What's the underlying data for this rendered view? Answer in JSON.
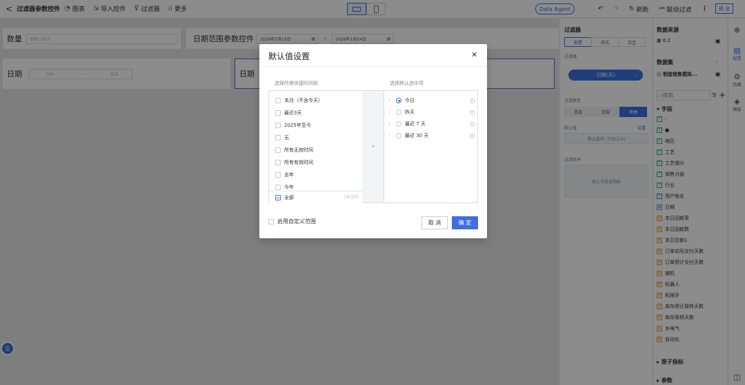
{
  "topbar": {
    "title": "过滤器参数控件",
    "items": [
      {
        "icon": "chart-icon",
        "label": "图表"
      },
      {
        "icon": "import-icon",
        "label": "导入控件"
      },
      {
        "icon": "filter-icon",
        "label": "过滤器"
      },
      {
        "icon": "more-icon",
        "label": "更多"
      }
    ],
    "data_agent": "Data Agent",
    "refresh": "刷新",
    "linked_filter": "联动过滤",
    "preview": "预 览"
  },
  "canvas": {
    "number_label": "数量",
    "number_placeholder": "请输入数字",
    "date_range_label": "日期范围参数控件",
    "date_from": "2026年1月23日",
    "date_sep": "-",
    "date_to": "2026年1月24日",
    "date_label": "日期",
    "start_placeholder": "开始",
    "arrow": "→",
    "end_placeholder": "结束",
    "date_label2": "日期"
  },
  "filter_panel": {
    "title": "过滤器",
    "tabs": [
      "配置",
      "样式",
      "交互"
    ],
    "filter_label": "过滤器",
    "filter_value": "日期(天)",
    "type_label": "过滤类型",
    "type_options": [
      "单选",
      "范围",
      "快捷"
    ],
    "default_label": "默认值",
    "default_set": "设置",
    "default_value": "默认选中: 今日(1/4)",
    "conditions_label": "过滤条件",
    "conditions_placeholder": "拖入字段或指标"
  },
  "data_panel": {
    "source_title": "数据来源",
    "source_value": "6.2",
    "dataset_title": "数据集",
    "dataset_value": "制造销售模拟...",
    "search_placeholder": "搜索",
    "fields_title": "字段",
    "fields": [
      {
        "type": "T",
        "name": "-"
      },
      {
        "type": "T",
        "name": "●"
      },
      {
        "type": "T",
        "name": "地区"
      },
      {
        "type": "T",
        "name": "工艺"
      },
      {
        "type": "T",
        "name": "工艺细分"
      },
      {
        "type": "T",
        "name": "销售分组"
      },
      {
        "type": "T",
        "name": "行业"
      },
      {
        "type": "T",
        "name": "用户姓名"
      },
      {
        "type": "D",
        "name": "日期"
      },
      {
        "type": "N",
        "name": "本日回款率"
      },
      {
        "type": "N",
        "name": "本日回款数"
      },
      {
        "type": "N",
        "name": "本日总额1"
      },
      {
        "type": "N",
        "name": "订单实际交付天数"
      },
      {
        "type": "N",
        "name": "订单预计交付天数"
      },
      {
        "type": "N",
        "name": "辅机"
      },
      {
        "type": "N",
        "name": "机器人"
      },
      {
        "type": "N",
        "name": "机械手"
      },
      {
        "type": "N",
        "name": "库存预计周转天数"
      },
      {
        "type": "N",
        "name": "库存周转天数"
      },
      {
        "type": "N",
        "name": "水电气"
      },
      {
        "type": "N",
        "name": "自动化"
      }
    ],
    "atomic_title": "原子指标",
    "params_title": "参数"
  },
  "icon_panel": {
    "config": "配置",
    "page": "页面",
    "layers": "图层"
  },
  "modal": {
    "title": "默认值设置",
    "left_head": "选择所需快捷时间段",
    "right_head": "选择默认选中项",
    "left_options": [
      "本月（不含今天）",
      "最近3天",
      "2025年至今",
      "无",
      "所有无效时间",
      "所有有效时间",
      "去年",
      "今年"
    ],
    "select_all": "全部",
    "select_count": "(4/20)",
    "right_options": [
      "今日",
      "昨天",
      "最近 7 天",
      "最近 30 天"
    ],
    "selected_index": 0,
    "custom_range": "启用自定义范围",
    "cancel": "取 消",
    "ok": "确 定",
    "transfer_icon": "»"
  }
}
